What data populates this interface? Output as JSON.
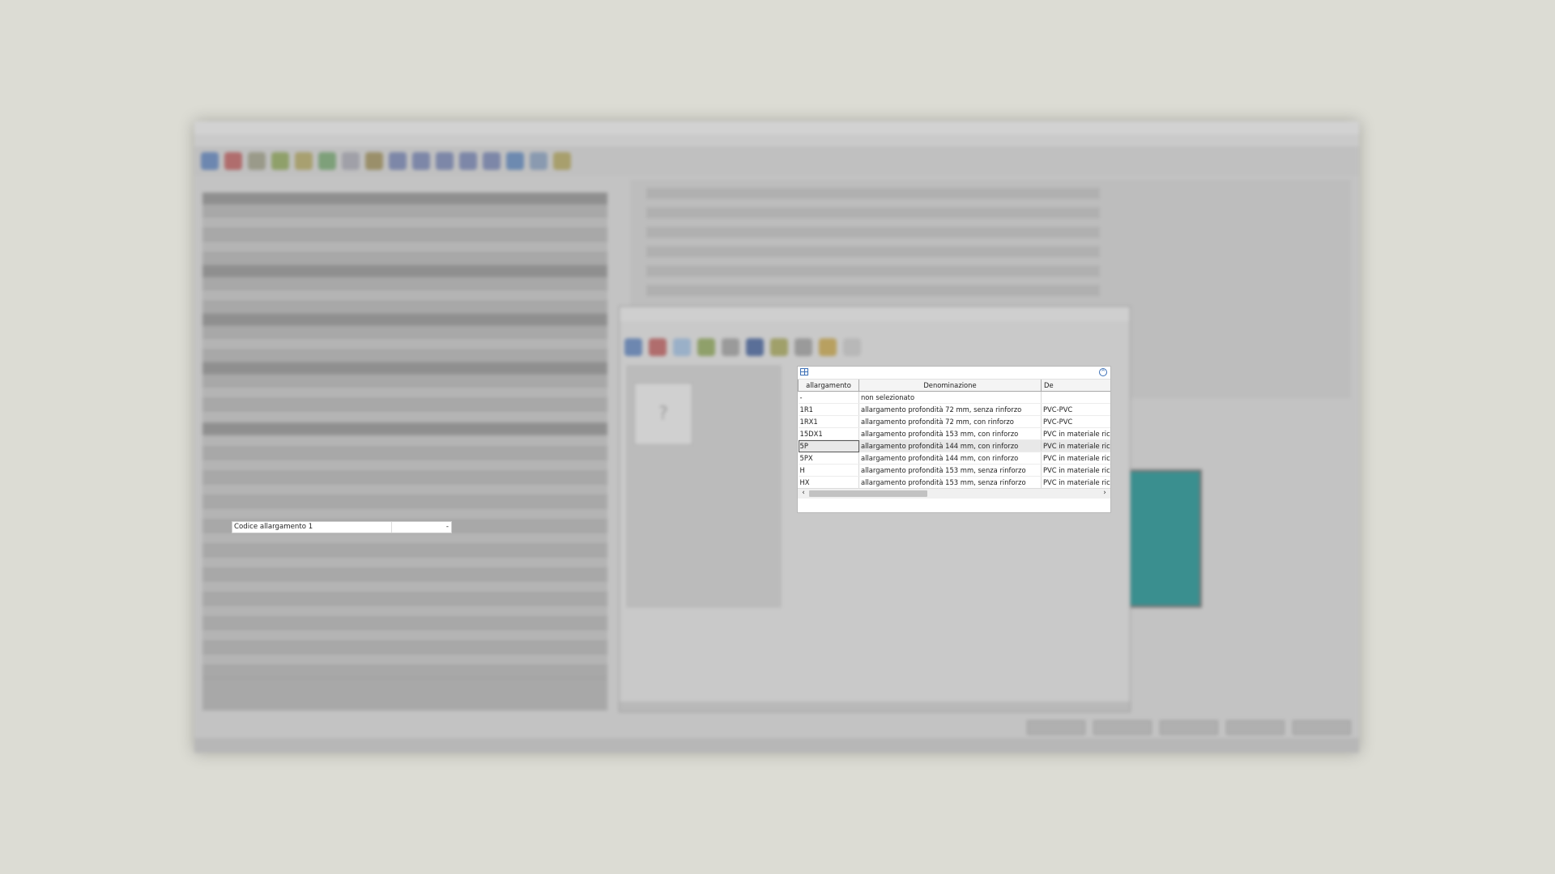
{
  "lookup_table": {
    "columns": [
      "allargamento",
      "Denominazione",
      "De"
    ],
    "rows": [
      {
        "code": "-",
        "name": "non selezionato",
        "desc": ""
      },
      {
        "code": "1R1",
        "name": "allargamento profondità 72 mm, senza rinforzo",
        "desc": "PVC-PVC"
      },
      {
        "code": "1RX1",
        "name": "allargamento profondità 72 mm, con rinforzo",
        "desc": "PVC-PVC"
      },
      {
        "code": "15DX1",
        "name": "allargamento profondità 153 mm, con rinforzo",
        "desc": "PVC in materiale ricicla"
      },
      {
        "code": "5P",
        "name": "allargamento profondità 144 mm, con rinforzo",
        "desc": "PVC in materiale ricicla"
      },
      {
        "code": "5PX",
        "name": "allargamento profondità 144 mm, con rinforzo",
        "desc": "PVC in materiale ricicla"
      },
      {
        "code": "H",
        "name": "allargamento profondità 153 mm, senza rinforzo",
        "desc": "PVC in materiale ricicla"
      },
      {
        "code": "HX",
        "name": "allargamento profondità 153 mm, senza rinforzo",
        "desc": "PVC in materiale ricicla"
      }
    ],
    "selected_row": 4
  },
  "edit_field": {
    "label": "Codice allargamento 1",
    "value": "-"
  },
  "icons": {
    "table_icon": "grid-icon",
    "collapse_icon": "collapse-icon",
    "scroll_left": "‹",
    "scroll_right": "›"
  },
  "colors": {
    "selection": "#e8e8e8",
    "accent": "#3b6fb6",
    "drawing_fill": "#3a8f8f"
  }
}
